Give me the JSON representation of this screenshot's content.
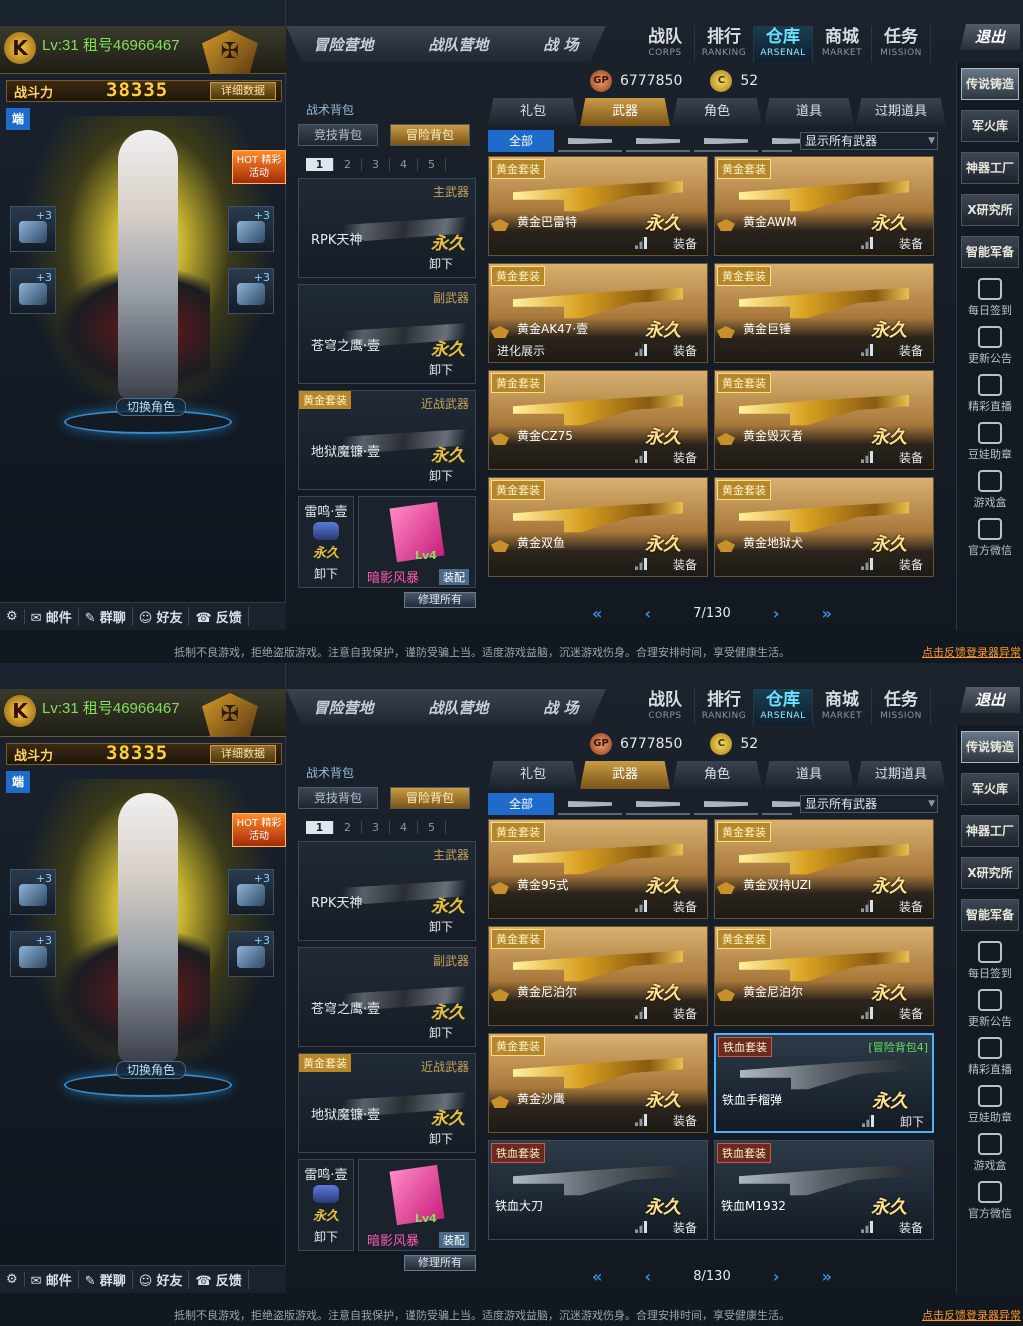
{
  "shared": {
    "player": {
      "level_text": "Lv:31 租号46966467"
    },
    "power": {
      "label": "战斗力",
      "value": "38335",
      "detail_btn": "详细数据"
    },
    "badge_duan": "端",
    "hot_badge": "HOT 精彩活动",
    "equip_plus": [
      "+3",
      "+3",
      "+3",
      "+3"
    ],
    "switch_role": "切换角色",
    "bottom_links": [
      "邮件",
      "群聊",
      "好友",
      "反馈"
    ],
    "top_tabs": [
      "冒险营地",
      "战队营地",
      "战 场"
    ],
    "nav": [
      {
        "cn": "战队",
        "en": "CORPS"
      },
      {
        "cn": "排行",
        "en": "RANKING"
      },
      {
        "cn": "仓库",
        "en": "ARSENAL"
      },
      {
        "cn": "商城",
        "en": "MARKET"
      },
      {
        "cn": "任务",
        "en": "MISSION"
      }
    ],
    "exit": "退出",
    "right_buttons": [
      "传说铸造",
      "军火库",
      "神器工厂",
      "X研究所",
      "智能军备"
    ],
    "right_icons": [
      "每日签到",
      "更新公告",
      "精彩直播",
      "豆娃助章",
      "游戏盒",
      "官方微信"
    ],
    "currency": {
      "gp_icon": "GP",
      "gp": "6777850",
      "c_icon": "C",
      "c": "52"
    },
    "bag_label": "战术背包",
    "bag_tabs": [
      "竞技背包",
      "冒险背包"
    ],
    "bag_pages": [
      "1",
      "2",
      "3",
      "4",
      "5"
    ],
    "primary": {
      "type": "主武器",
      "name": "RPK天神",
      "perm": "永久",
      "unload": "卸下"
    },
    "secondary": {
      "type": "副武器",
      "name": "苍穹之鹰·壹",
      "perm": "永久",
      "unload": "卸下"
    },
    "melee": {
      "set": "黄金套装",
      "type": "近战武器",
      "name": "地狱魔镰·壹",
      "perm": "永久",
      "unload": "卸下"
    },
    "throw": {
      "name": "雷鸣·壹",
      "perm": "永久",
      "unload": "卸下"
    },
    "card": {
      "name": "暗影风暴",
      "level": "Lv4",
      "equip": "装配"
    },
    "repair": "修理所有",
    "cat_tabs": [
      "礼包",
      "武器",
      "角色",
      "道具",
      "过期道具"
    ],
    "filter_all": "全部",
    "filter_select": "显示所有武器",
    "notice": "抵制不良游戏，拒绝盗版游戏。注意自我保护，谨防受骗上当。适度游戏益脑，沉迷游戏伤身。合理安排时间，享受健康生活。",
    "feedback_link": "点击反馈登录器异常",
    "permanent": "永久",
    "equip_action": "装备"
  },
  "screens": [
    {
      "page": "7/130",
      "weapons": [
        {
          "tag": "黄金套装",
          "name": "黄金巴雷特",
          "action": "装备",
          "extra": ""
        },
        {
          "tag": "黄金套装",
          "name": "黄金AWM",
          "action": "装备",
          "extra": ""
        },
        {
          "tag": "黄金套装",
          "name": "黄金AK47·壹",
          "action": "装备",
          "extra": "进化展示"
        },
        {
          "tag": "黄金套装",
          "name": "黄金巨锤",
          "action": "装备",
          "extra": ""
        },
        {
          "tag": "黄金套装",
          "name": "黄金CZ75",
          "action": "装备",
          "extra": ""
        },
        {
          "tag": "黄金套装",
          "name": "黄金毁灭者",
          "action": "装备",
          "extra": ""
        },
        {
          "tag": "黄金套装",
          "name": "黄金双鱼",
          "action": "装备",
          "extra": ""
        },
        {
          "tag": "黄金套装",
          "name": "黄金地狱犬",
          "action": "装备",
          "extra": ""
        }
      ]
    },
    {
      "page": "8/130",
      "weapons": [
        {
          "tag": "黄金套装",
          "name": "黄金95式",
          "action": "装备",
          "extra": ""
        },
        {
          "tag": "黄金套装",
          "name": "黄金双持UZI",
          "action": "装备",
          "extra": ""
        },
        {
          "tag": "黄金套装",
          "name": "黄金尼泊尔",
          "action": "装备",
          "extra": ""
        },
        {
          "tag": "黄金套装",
          "name": "黄金尼泊尔",
          "action": "装备",
          "extra": ""
        },
        {
          "tag": "黄金套装",
          "name": "黄金沙鹰",
          "action": "装备",
          "extra": ""
        },
        {
          "tag": "铁血套装",
          "name": "铁血手榴弹",
          "action": "卸下",
          "extra": "",
          "note": "[冒险背包4]",
          "selected": true,
          "iron": true
        },
        {
          "tag": "铁血套装",
          "name": "铁血大刀",
          "action": "装备",
          "extra": "",
          "iron": true
        },
        {
          "tag": "铁血套装",
          "name": "铁血M1932",
          "action": "装备",
          "extra": "",
          "iron": true
        }
      ]
    }
  ],
  "colors": {
    "accent": "#1f6bcc",
    "gold": "#c99b44",
    "permanent": "#e8c23a",
    "nav_active": "#6ee0ff"
  }
}
